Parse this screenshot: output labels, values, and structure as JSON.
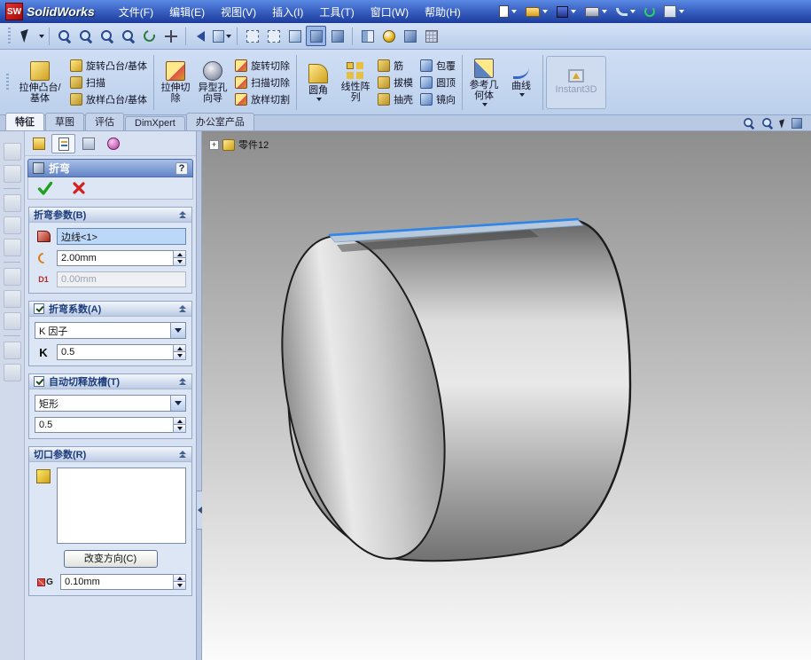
{
  "titlebar": {
    "logo_text": "SW",
    "app_name": "SolidWorks",
    "menus": [
      "文件(F)",
      "编辑(E)",
      "视图(V)",
      "插入(I)",
      "工具(T)",
      "窗口(W)",
      "帮助(H)"
    ]
  },
  "feature_toolbar": {
    "extrude_boss": "拉伸凸台/基体",
    "revolve_boss": "旋转凸台/基体",
    "sweep": "扫描",
    "loft": "放样凸台/基体",
    "extrude_cut": "拉伸切除",
    "hole_wizard": "异型孔向导",
    "revolve_cut": "旋转切除",
    "sweep_cut": "扫描切除",
    "loft_cut": "放样切割",
    "fillet": "圆角",
    "linear_pattern": "线性阵列",
    "rib": "筋",
    "draft": "拔模",
    "shell": "抽壳",
    "wrap": "包覆",
    "dome": "圆顶",
    "mirror": "镜向",
    "reference_geometry": "参考几何体",
    "curves": "曲线",
    "instant3d": "Instant3D"
  },
  "command_tabs": [
    "特征",
    "草图",
    "评估",
    "DimXpert",
    "办公室产品"
  ],
  "property_manager": {
    "title": "折弯",
    "help_label": "?",
    "bend_params": {
      "header": "折弯参数(B)",
      "edge": "边线<1>",
      "radius": "2.00mm",
      "distance_label": "D1",
      "distance": "0.00mm"
    },
    "bend_allowance": {
      "header": "折弯系数(A)",
      "type": "K 因子",
      "k_label": "K",
      "k_value": "0.5"
    },
    "auto_relief": {
      "header": "自动切释放槽(T)",
      "type": "矩形",
      "ratio": "0.5"
    },
    "rip": {
      "header": "切口参数(R)",
      "change_direction": "改变方向(C)",
      "gap_label": "G",
      "gap": "0.10mm"
    }
  },
  "viewport": {
    "tree_expander": "+",
    "part_name": "零件12"
  },
  "colors": {
    "selected_edge": "#2f86e8",
    "titlebar_blue": "#1c3c9c",
    "selection_field": "#bcd8f8"
  }
}
